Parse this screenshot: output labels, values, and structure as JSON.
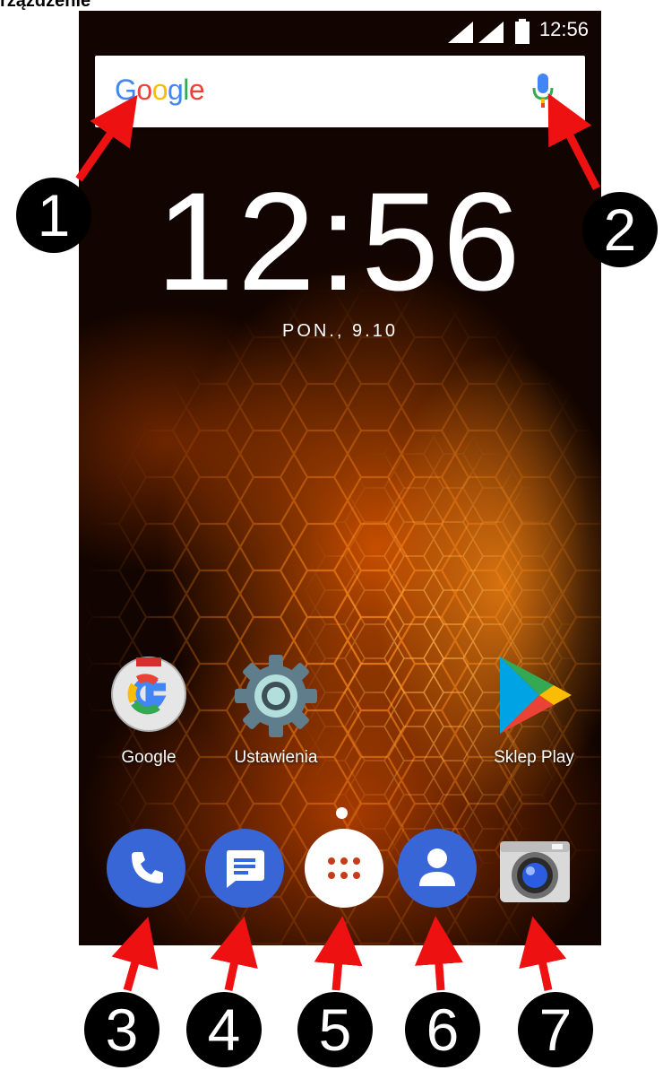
{
  "top_crop_text": "rzązdzenie",
  "status_bar": {
    "time": "12:56",
    "icons": [
      "signal-icon",
      "signal-icon",
      "battery-icon"
    ]
  },
  "search_bar": {
    "logo": "Google",
    "mic_icon": "microphone-icon"
  },
  "clock": {
    "time": "12:56",
    "date": "PON., 9.10"
  },
  "apps": [
    {
      "label": "Google",
      "icon": "google-app-icon"
    },
    {
      "label": "Ustawienia",
      "icon": "settings-gear-icon"
    },
    {
      "label": "Sklep Play",
      "icon": "play-store-icon"
    }
  ],
  "dock": [
    {
      "icon": "phone-icon"
    },
    {
      "icon": "messages-icon"
    },
    {
      "icon": "app-drawer-icon"
    },
    {
      "icon": "contacts-icon"
    },
    {
      "icon": "camera-icon"
    }
  ],
  "callouts": [
    "1",
    "2",
    "3",
    "4",
    "5",
    "6",
    "7"
  ],
  "colors": {
    "accent_orange": "#ff7a00",
    "arrow_red": "#ee1111",
    "dock_blue": "#3866d6"
  }
}
